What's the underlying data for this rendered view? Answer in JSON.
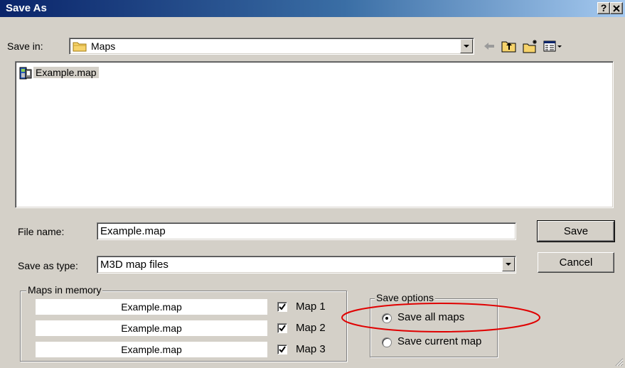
{
  "window": {
    "title": "Save As",
    "help_label": "?",
    "close_label": "✕"
  },
  "toolbar": {
    "save_in_label": "Save in:",
    "save_in_value": "Maps",
    "icons": [
      "back-arrow-icon",
      "up-folder-icon",
      "new-folder-icon",
      "view-menu-icon"
    ]
  },
  "files": [
    {
      "name": "Example.map",
      "icon": "map-file-icon"
    }
  ],
  "form": {
    "file_name_label": "File name:",
    "file_name_value": "Example.map",
    "save_type_label": "Save as type:",
    "save_type_value": "M3D map files",
    "save_button": "Save",
    "cancel_button": "Cancel"
  },
  "maps_in_memory": {
    "title": "Maps in memory",
    "rows": [
      {
        "file": "Example.map",
        "label": "Map 1",
        "checked": true
      },
      {
        "file": "Example.map",
        "label": "Map 2",
        "checked": true
      },
      {
        "file": "Example.map",
        "label": "Map 3",
        "checked": true
      }
    ]
  },
  "save_options": {
    "title": "Save options",
    "options": [
      {
        "label": "Save all maps",
        "selected": true
      },
      {
        "label": "Save current map",
        "selected": false
      }
    ]
  },
  "colors": {
    "title_bar_start": "#0a246a",
    "title_bar_end": "#a6caf0",
    "face": "#d4d0c8",
    "annotation_ellipse": "#e00000"
  }
}
